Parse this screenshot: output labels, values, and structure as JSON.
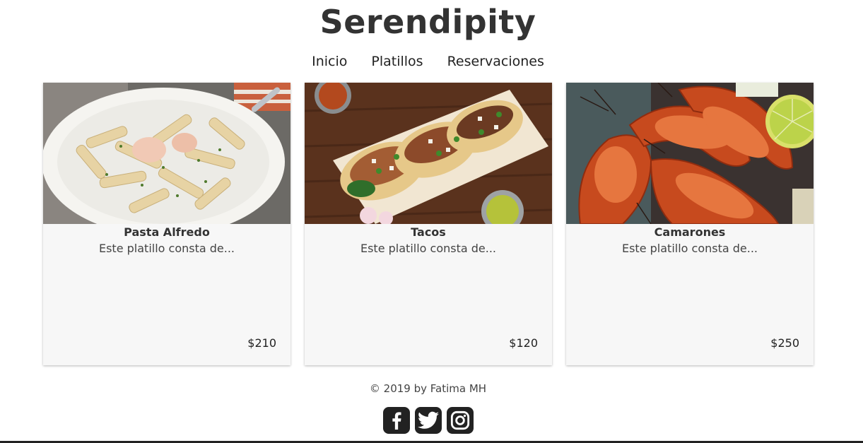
{
  "site": {
    "title": "Serendipity"
  },
  "nav": {
    "items": [
      {
        "label": "Inicio"
      },
      {
        "label": "Platillos"
      },
      {
        "label": "Reservaciones"
      }
    ]
  },
  "dishes": [
    {
      "name": "Pasta Alfredo",
      "description": "Este platillo consta de...",
      "price": "$210",
      "image": "pasta-photo"
    },
    {
      "name": "Tacos",
      "description": "Este platillo consta de...",
      "price": "$120",
      "image": "tacos-photo"
    },
    {
      "name": "Camarones",
      "description": "Este platillo consta de...",
      "price": "$250",
      "image": "shrimp-photo"
    }
  ],
  "footer": {
    "copyright": "© 2019 by Fatima MH",
    "social": [
      {
        "icon": "facebook-icon"
      },
      {
        "icon": "twitter-icon"
      },
      {
        "icon": "instagram-icon"
      }
    ]
  },
  "colors": {
    "text": "#333333",
    "card_bg": "#f7f7f7",
    "icon_bg": "#222222"
  }
}
